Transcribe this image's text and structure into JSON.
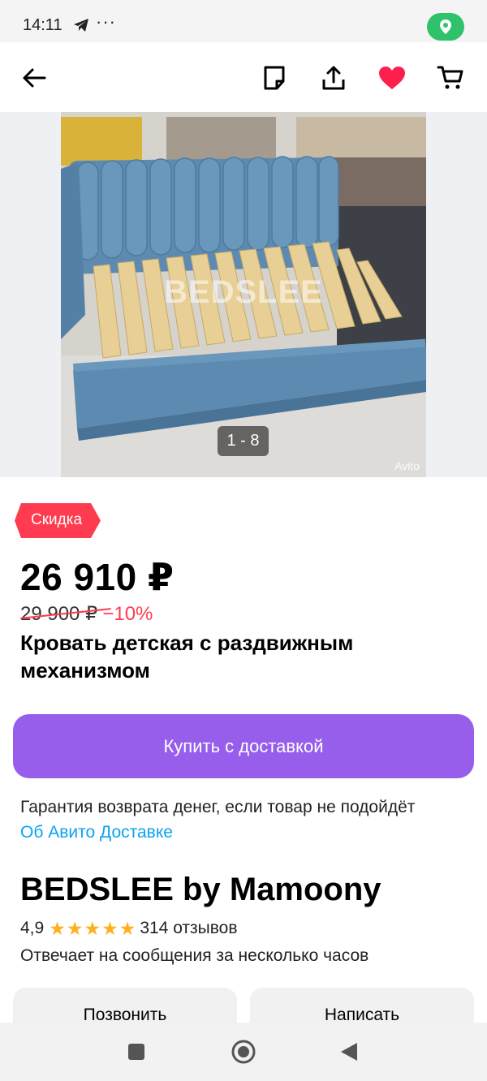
{
  "status_bar": {
    "time": "14:11",
    "dots": "···",
    "icons": [
      "telegram-icon",
      "location-icon"
    ],
    "location_color": "#2fc26b"
  },
  "app_bar": {
    "icons": [
      "back-arrow-icon",
      "note-icon",
      "share-icon",
      "heart-icon",
      "cart-icon"
    ],
    "favorite_color": "#ff1f4f"
  },
  "gallery": {
    "watermark": "BEDSLEE",
    "counter": "1 - 8",
    "avito_mark": "Avito"
  },
  "listing": {
    "badge": "Скидка",
    "price": "26 910 ₽",
    "old_price": "29 900 ₽",
    "discount": "−10%",
    "title": "Кровать детская с раздвижным механизмом",
    "buy_button": "Купить с доставкой",
    "guarantee": "Гарантия возврата денег, если товар не подойдёт",
    "delivery_link": "Об Авито Доставке"
  },
  "seller": {
    "name": "BEDSLEE by Mamoony",
    "rating": "4,9",
    "stars": 5,
    "reviews": "314 отзывов",
    "response": "Отвечает на сообщения за несколько часов",
    "call_button": "Позвонить",
    "message_button": "Написать"
  },
  "colors": {
    "accent": "#965eeb",
    "link": "#0aa3f2",
    "badge": "#ff3b4f",
    "star": "#ffb021"
  },
  "nav_bar": {
    "icons": [
      "recents-icon",
      "home-icon",
      "back-icon"
    ]
  }
}
